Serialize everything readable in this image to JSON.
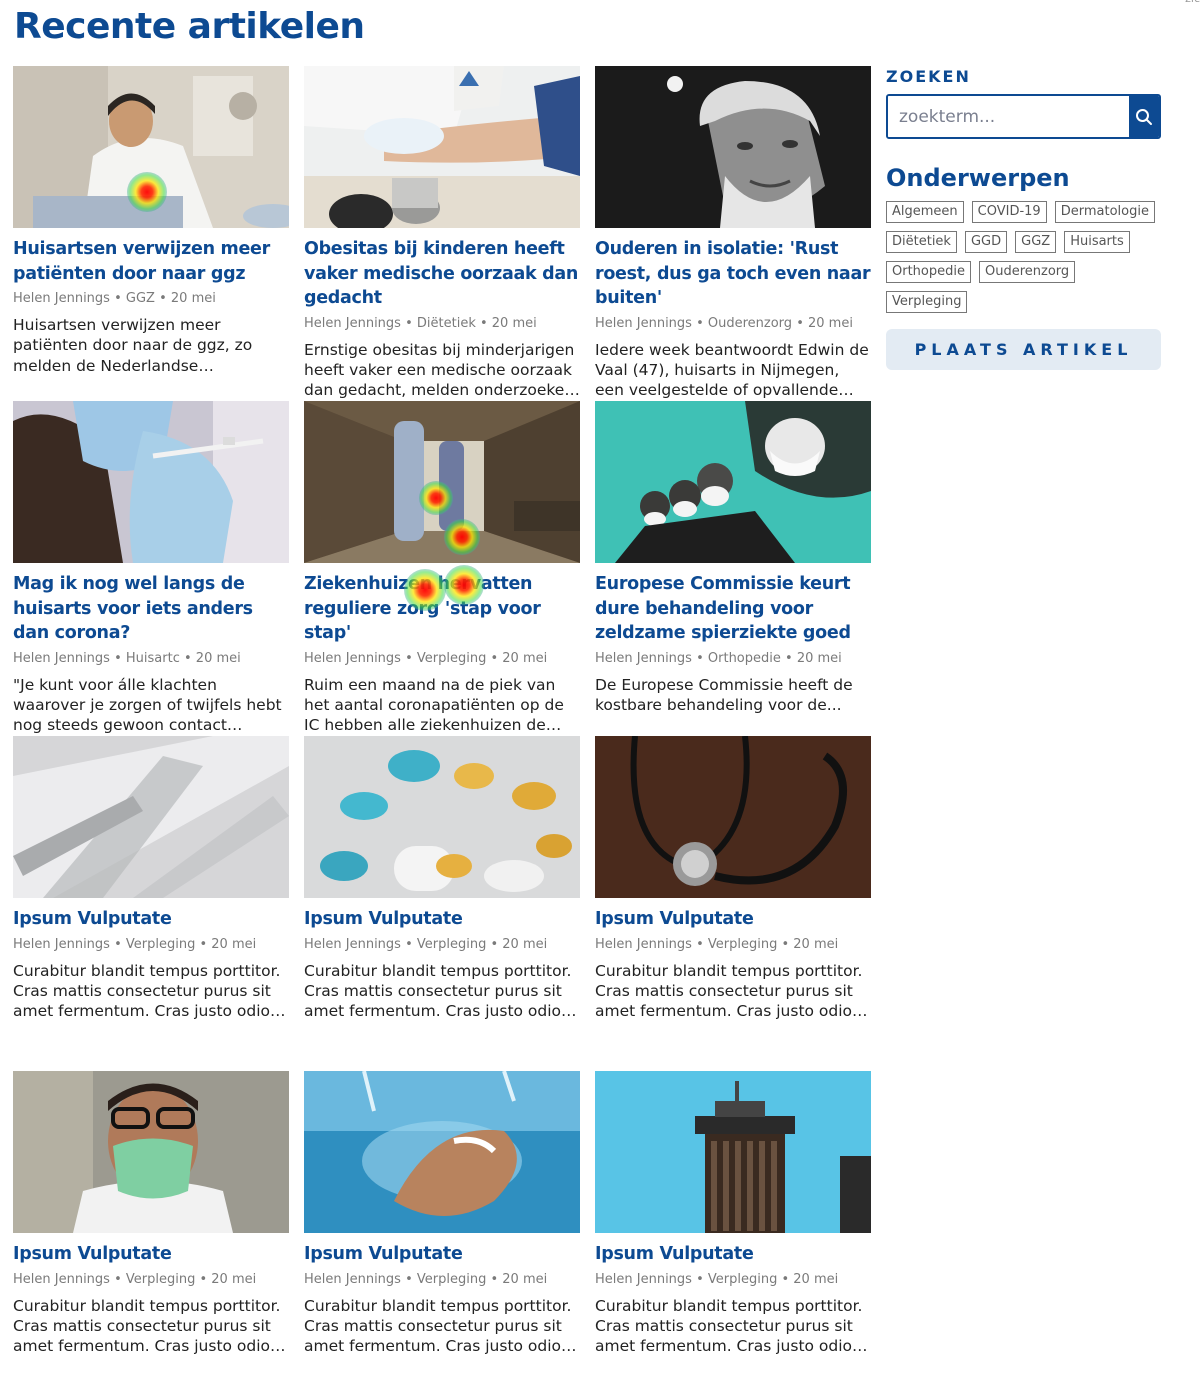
{
  "corner_text": "zic",
  "page_title": "Recente artikelen",
  "articles": [
    {
      "title": "Huisartsen verwijzen meer patiënten door naar ggz",
      "author": "Helen Jennings",
      "category": "GGZ",
      "date": "20 mei",
      "excerpt": "Huisartsen verwijzen meer patiënten door naar de ggz, zo melden de Nederlandse Zorgautoriteit (NZa) en..."
    },
    {
      "title": "Obesitas bij kinderen heeft vaker medische oorzaak dan gedacht",
      "author": "Helen Jennings",
      "category": "Diëtetiek",
      "date": "20 mei",
      "excerpt": "Ernstige obesitas bij minderjarigen heeft vaker een medische oorzaak dan gedacht, melden onderzoekers van..."
    },
    {
      "title": "Ouderen in isolatie: 'Rust roest, dus ga toch even naar buiten'",
      "author": "Helen Jennings",
      "category": "Ouderenzorg",
      "date": "20 mei",
      "excerpt": "Iedere week beantwoordt Edwin de Vaal (47), huisarts in Nijmegen, een veelgestelde of opvallende vraag uit..."
    },
    {
      "title": "Mag ik nog wel langs de huisarts voor iets anders dan corona?",
      "author": "Helen Jennings",
      "category": "Huisartc",
      "date": "20 mei",
      "excerpt": "\"Je kunt voor álle klachten waarover je zorgen of twijfels hebt nog steeds gewoon contact opnemen met de..."
    },
    {
      "title": "Ziekenhuizen hervatten reguliere zorg 'stap voor stap'",
      "author": "Helen Jennings",
      "category": "Verpleging",
      "date": "20 mei",
      "excerpt": "Ruim een maand na de piek van het aantal coronapatiënten op de IC hebben alle ziekenhuizen de reguliere..."
    },
    {
      "title": "Europese Commissie keurt dure behandeling voor zeldzame spierziekte goed",
      "author": "Helen Jennings",
      "category": "Orthopedie",
      "date": "20 mei",
      "excerpt": "De Europese Commissie heeft de kostbare behandeling voor de..."
    },
    {
      "title": "Ipsum Vulputate",
      "author": "Helen Jennings",
      "category": "Verpleging",
      "date": "20 mei",
      "excerpt": "Curabitur blandit tempus porttitor. Cras mattis consectetur purus sit amet fermentum. Cras justo odio, dapibus ac facilisis in, egestas eget quam..."
    },
    {
      "title": "Ipsum Vulputate",
      "author": "Helen Jennings",
      "category": "Verpleging",
      "date": "20 mei",
      "excerpt": "Curabitur blandit tempus porttitor. Cras mattis consectetur purus sit amet fermentum. Cras justo odio, dapibus ac facilisis in, egestas eget quam..."
    },
    {
      "title": "Ipsum Vulputate",
      "author": "Helen Jennings",
      "category": "Verpleging",
      "date": "20 mei",
      "excerpt": "Curabitur blandit tempus porttitor. Cras mattis consectetur purus sit amet fermentum. Cras justo odio, dapibus ac facilisis in, egestas eget quam..."
    },
    {
      "title": "Ipsum Vulputate",
      "author": "Helen Jennings",
      "category": "Verpleging",
      "date": "20 mei",
      "excerpt": "Curabitur blandit tempus porttitor. Cras mattis consectetur purus sit amet fermentum. Cras justo odio, dapibus ac facilisis in, egestas eget quam..."
    },
    {
      "title": "Ipsum Vulputate",
      "author": "Helen Jennings",
      "category": "Verpleging",
      "date": "20 mei",
      "excerpt": "Curabitur blandit tempus porttitor. Cras mattis consectetur purus sit amet fermentum. Cras justo odio, dapibus ac facilisis in, egestas eget quam..."
    },
    {
      "title": "Ipsum Vulputate",
      "author": "Helen Jennings",
      "category": "Verpleging",
      "date": "20 mei",
      "excerpt": "Curabitur blandit tempus porttitor. Cras mattis consectetur purus sit amet fermentum. Cras justo odio, dapibus ac facilisis in, egestas eget quam..."
    }
  ],
  "sidebar": {
    "search_label": "ZOEKEN",
    "search_placeholder": "zoekterm...",
    "topics_title": "Onderwerpen",
    "tags": [
      "Algemeen",
      "COVID-19",
      "Dermatologie",
      "Diëtetiek",
      "GGD",
      "GGZ",
      "Huisarts",
      "Orthopedie",
      "Ouderenzorg",
      "Verpleging"
    ],
    "post_button": "PLAATS ARTIKEL"
  },
  "colors": {
    "accent": "#0d4a92",
    "button_bg": "#e3ebf3"
  }
}
